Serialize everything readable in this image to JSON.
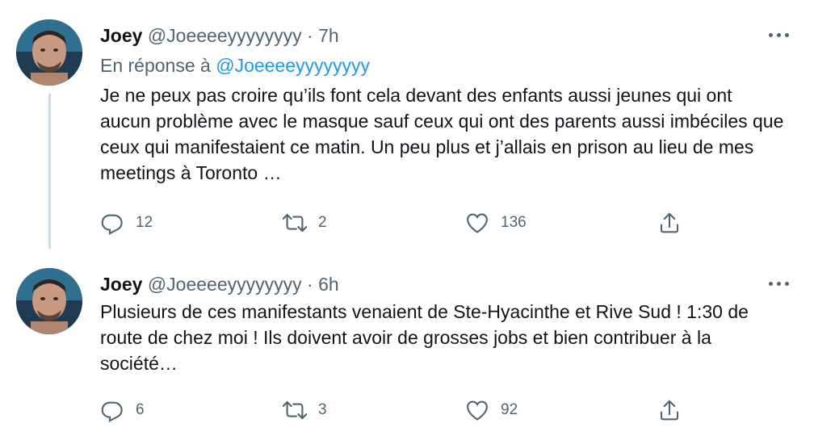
{
  "tweets": [
    {
      "author": {
        "name": "Joey",
        "handle": "@Joeeeeyyyyyyyy"
      },
      "separator": "·",
      "time": "7h",
      "reply_prefix": "En réponse à",
      "reply_mention": "@Joeeeeyyyyyyyy",
      "text": "Je ne peux pas croire qu’ils font cela devant des enfants aussi jeunes qui ont aucun problème avec le masque sauf ceux qui ont des parents aussi imbéciles que ceux qui manifestaient ce matin. Un peu plus et j’allais en prison au lieu de mes meetings à Toronto …",
      "stats": {
        "replies": "12",
        "retweets": "2",
        "likes": "136"
      }
    },
    {
      "author": {
        "name": "Joey",
        "handle": "@Joeeeeyyyyyyyy"
      },
      "separator": "·",
      "time": "6h",
      "text": "Plusieurs de ces manifestants venaient de Ste-Hyacinthe et Rive Sud ! 1:30 de route de chez moi ! Ils doivent avoir de grosses jobs et bien contribuer à la société…",
      "stats": {
        "replies": "6",
        "retweets": "3",
        "likes": "92"
      }
    }
  ],
  "icons": {
    "reply": "reply-icon",
    "retweet": "retweet-icon",
    "like": "heart-icon",
    "share": "share-icon",
    "more": "more-icon"
  },
  "colors": {
    "link": "#1d9bf0",
    "muted": "#536471",
    "text": "#0f1419",
    "thread": "#cfd9de"
  }
}
